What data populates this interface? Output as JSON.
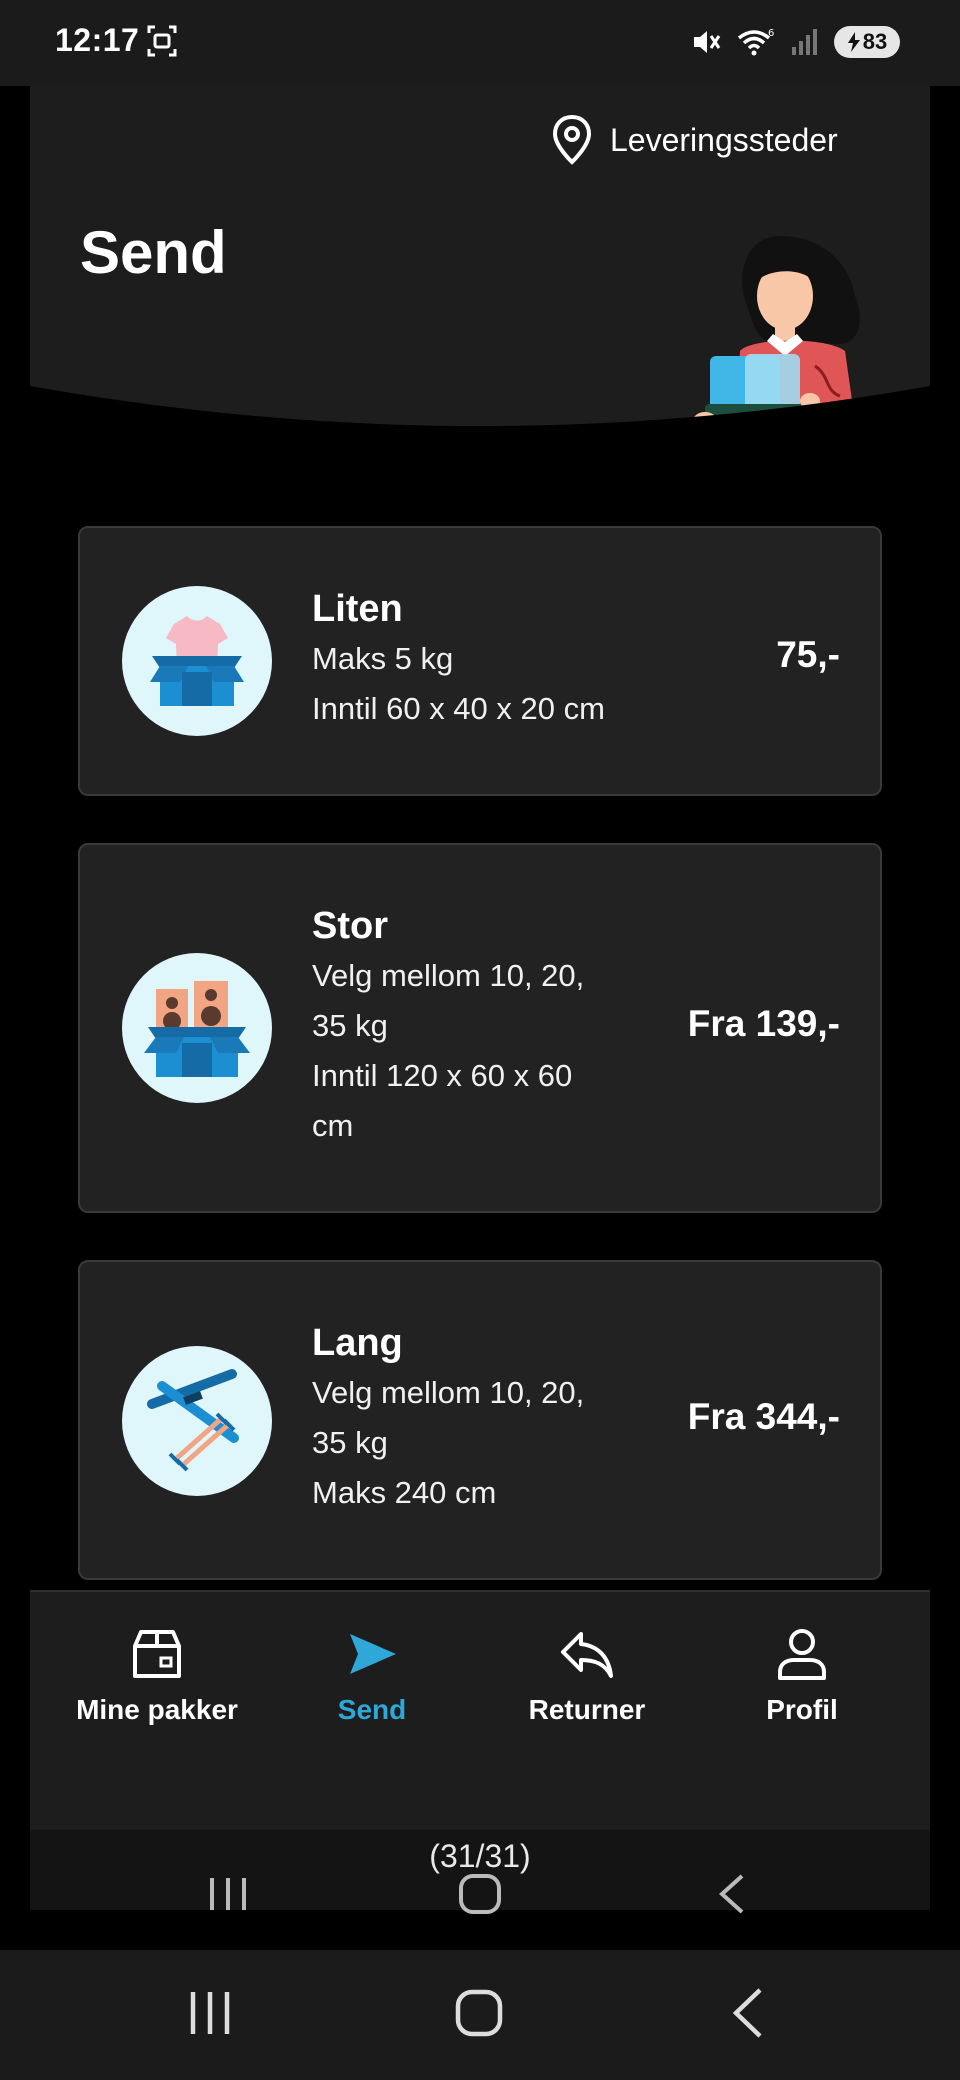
{
  "status_bar": {
    "time": "12:17",
    "battery": "83"
  },
  "header": {
    "location_label": "Leveringssteder",
    "title": "Send"
  },
  "packages": [
    {
      "title": "Liten",
      "lines": [
        "Maks 5 kg",
        "Inntil 60 x 40 x 20 cm"
      ],
      "price": "75,-",
      "icon": "box-tshirt-icon"
    },
    {
      "title": "Stor",
      "lines": [
        "Velg mellom 10, 20,",
        "35 kg",
        "Inntil 120 x 60 x 60",
        "cm"
      ],
      "price": "Fra 139,-",
      "icon": "box-speakers-icon"
    },
    {
      "title": "Lang",
      "lines": [
        "Velg mellom 10, 20,",
        "35 kg",
        "Maks 240 cm"
      ],
      "price": "Fra 344,-",
      "icon": "skis-icon"
    }
  ],
  "bottom_nav": {
    "items": [
      {
        "label": "Mine pakker",
        "icon": "package-icon",
        "active": false
      },
      {
        "label": "Send",
        "icon": "send-icon",
        "active": true
      },
      {
        "label": "Returner",
        "icon": "return-icon",
        "active": false
      },
      {
        "label": "Profil",
        "icon": "person-icon",
        "active": false
      }
    ]
  },
  "overlay": {
    "counter": "(31/31)"
  },
  "colors": {
    "accent": "#2fa7d8",
    "card_bg": "#222222",
    "header_bg": "#1d1d1d",
    "icon_circle": "#dff6fb"
  }
}
